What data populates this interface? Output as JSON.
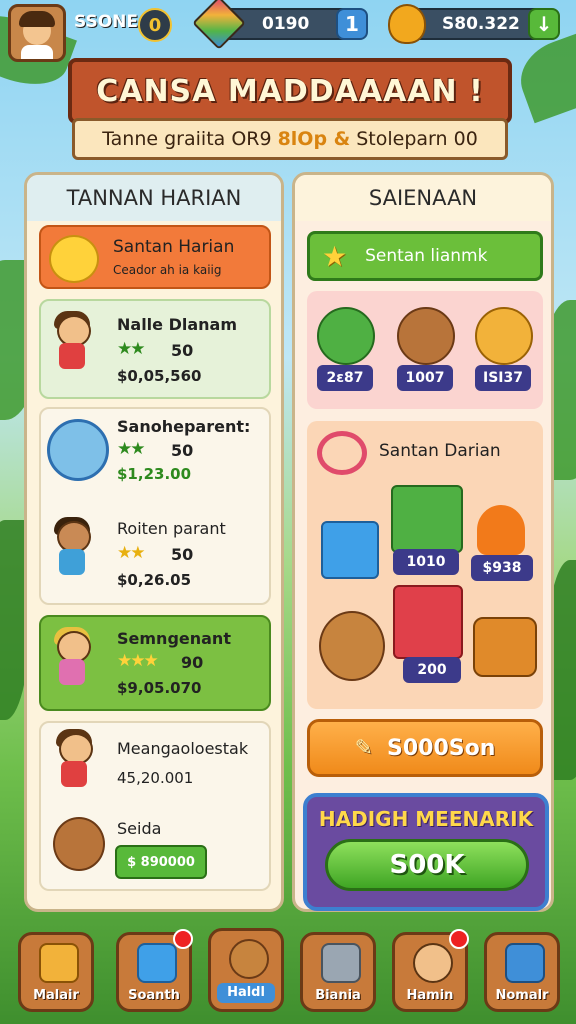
{
  "top": {
    "player_name": "SSONE",
    "level": "0",
    "gems": "0190",
    "gem_plus": "1",
    "coins": "S80.322",
    "coin_action": "↓"
  },
  "banner": {
    "title": "CANSA MADDAAAAN !",
    "subtitle_left": "Tanne graiita OR9",
    "subtitle_highlight": "8lOp &",
    "subtitle_right": "Stoleparn 00"
  },
  "left_panel": {
    "header": "TANNAN HARIAN",
    "featured": {
      "title": "Santan Harian",
      "subtitle": "Ceador ah ia kaiig"
    },
    "items": [
      {
        "name": "Nalle Dlanam",
        "score": "50",
        "value": "$0,05,560"
      },
      {
        "name": "Sanoheparent:",
        "score": "50",
        "value": "$1,23.00"
      },
      {
        "name": "Roiten parant",
        "score": "50",
        "value": "$0,26.05"
      },
      {
        "name": "Semngenant",
        "score": "90",
        "value": "$9,05.070"
      },
      {
        "name": "Meangaoloestak",
        "score": "",
        "value": "45,20.001"
      },
      {
        "name": "Seida",
        "score": "",
        "value": "$ 890000"
      }
    ]
  },
  "right_panel": {
    "header": "SAIENAAN",
    "top_button": "Sentan lianmk",
    "characters": [
      {
        "name": "green-creature",
        "tag": "2ɛ87"
      },
      {
        "name": "brown-bear",
        "tag": "1007"
      },
      {
        "name": "yellow-pup",
        "tag": "ISI37"
      }
    ],
    "rewards_title": "Santan Darian",
    "rewards": [
      {
        "name": "balloon-box",
        "tag": ""
      },
      {
        "name": "green-gift",
        "tag": "1010"
      },
      {
        "name": "fire-item",
        "tag": "$938"
      },
      {
        "name": "teddy-bear",
        "tag": ""
      },
      {
        "name": "red-gift",
        "tag": "200"
      },
      {
        "name": "toy-cart",
        "tag": ""
      }
    ],
    "action_button": "S000Son",
    "gift_title": "HADIGH MEENARIK",
    "gift_button": "S00K"
  },
  "nav": [
    {
      "label": "Malair",
      "icon": "shop-icon",
      "badge": false
    },
    {
      "label": "Soanth",
      "icon": "phone-icon",
      "badge": true
    },
    {
      "label": "Haldl",
      "icon": "pet-icon",
      "badge": false,
      "active": true
    },
    {
      "label": "Biania",
      "icon": "tools-icon",
      "badge": false
    },
    {
      "label": "Hamin",
      "icon": "friend-icon",
      "badge": true
    },
    {
      "label": "Nomalr",
      "icon": "robot-icon",
      "badge": false
    }
  ],
  "colors": {
    "accent_green": "#6bbf3a",
    "accent_orange": "#f08a1a",
    "banner_red": "#c0542c",
    "tag_blue": "#3c3a8a"
  }
}
